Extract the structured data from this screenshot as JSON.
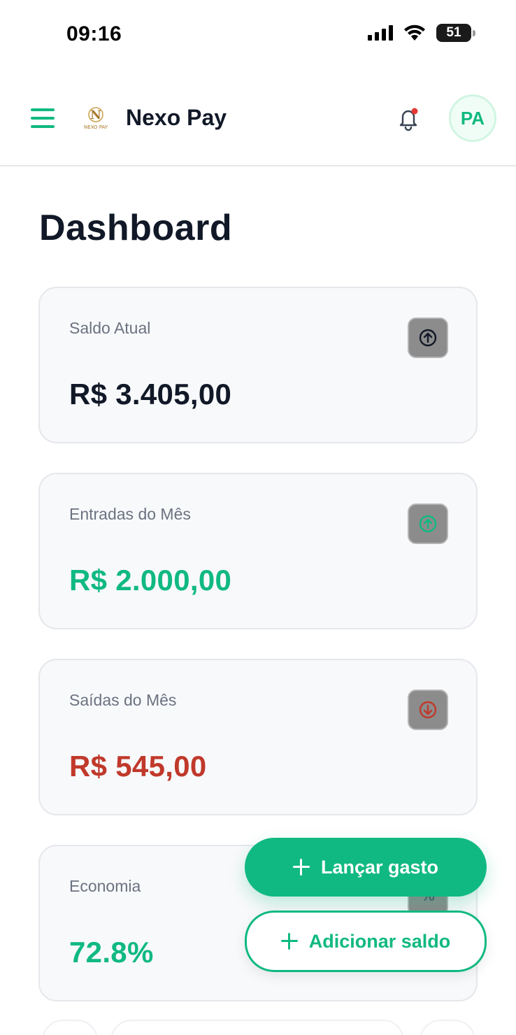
{
  "status_bar": {
    "time": "09:16",
    "battery_level": "51"
  },
  "header": {
    "brand_name": "Nexo Pay",
    "avatar_initials": "PA",
    "logo_text": "NEXO PAY"
  },
  "page": {
    "title": "Dashboard"
  },
  "cards": [
    {
      "label": "Saldo Atual",
      "value": "R$ 3.405,00",
      "icon": "arrow-up-circle-icon",
      "color": "#111827"
    },
    {
      "label": "Entradas do Mês",
      "value": "R$ 2.000,00",
      "icon": "arrow-up-circle-icon",
      "color": "#10b981"
    },
    {
      "label": "Saídas do Mês",
      "value": "R$ 545,00",
      "icon": "arrow-down-circle-icon",
      "color": "#c0392b"
    },
    {
      "label": "Economia",
      "value": "72.8%",
      "icon": "percent-icon",
      "color": "#10b981"
    }
  ],
  "actions": {
    "primary_label": "Lançar gasto",
    "secondary_label": "Adicionar saldo"
  },
  "colors": {
    "accent": "#10b981",
    "expense": "#c0392b",
    "text": "#111827"
  }
}
